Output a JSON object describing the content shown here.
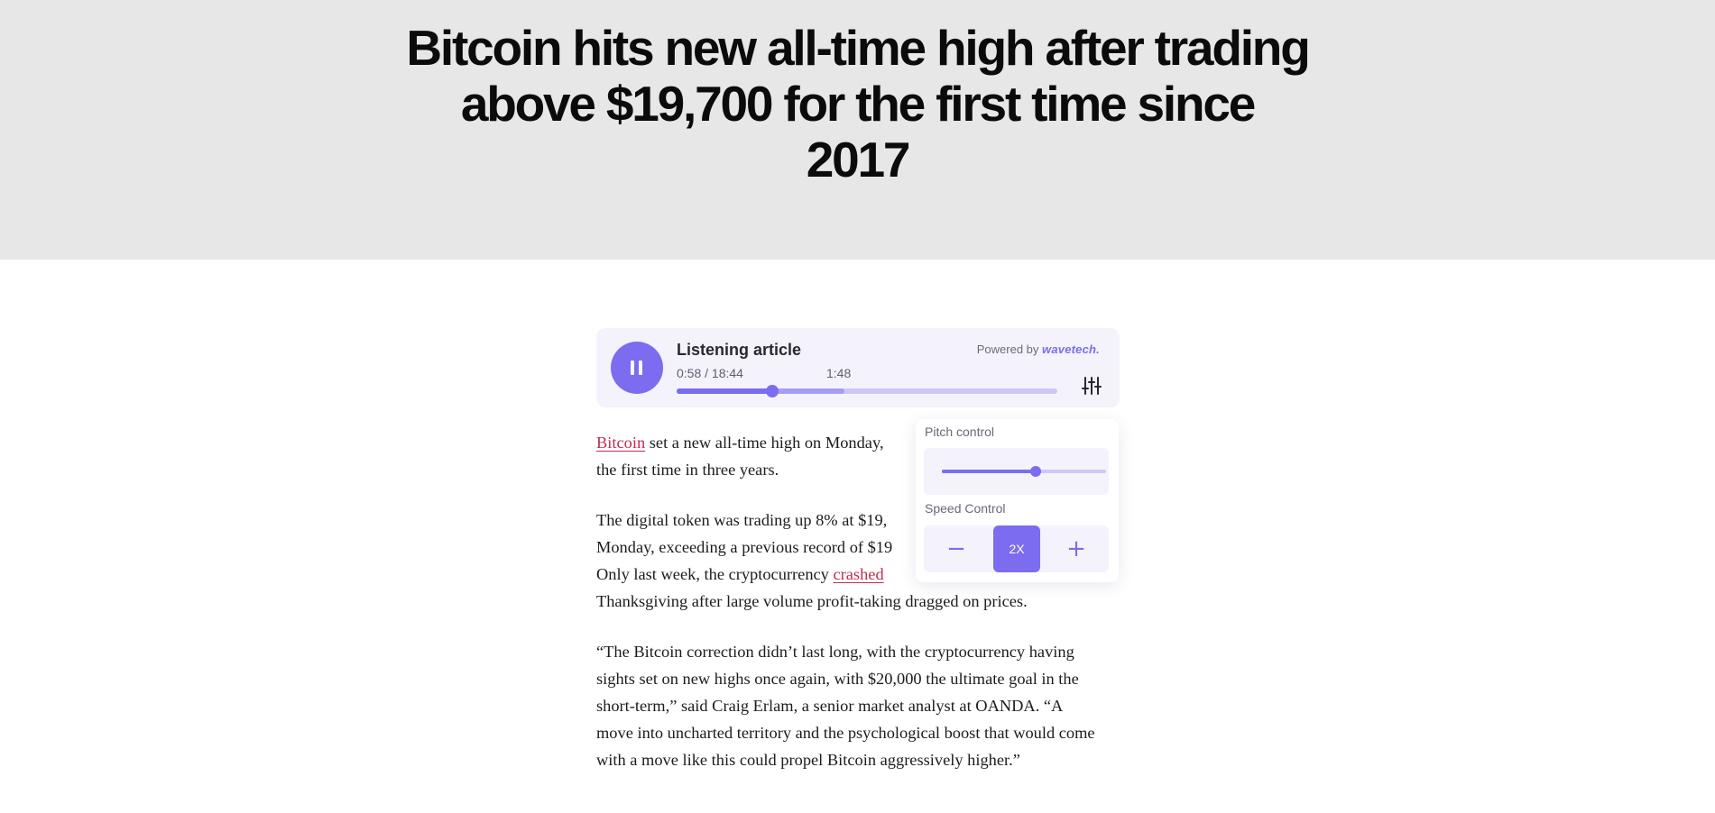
{
  "headline": "Bitcoin hits new all-time high after trading above $19,700 for the first time since 2017",
  "player": {
    "title": "Listening article",
    "powered_by": "Powered by",
    "brand": "wavetech.",
    "time_display": "0:58 / 18:44",
    "hover_time": "1:48",
    "progress_fraction": 0.25,
    "buffer_fraction": 0.44,
    "state": "playing",
    "icons": {
      "play_pause": "pause-icon",
      "settings": "sliders-icon"
    }
  },
  "settings_popup": {
    "pitch_label": "Pitch control",
    "pitch_fraction": 0.57,
    "speed_label": "Speed Control",
    "speed_value": "2X",
    "decrease_symbol": "−",
    "increase_symbol": "+"
  },
  "article": {
    "p1": {
      "link": "Bitcoin",
      "rest_line1": " set a new all-time high on Monday,",
      "line2": "the first time in three years."
    },
    "p2": {
      "line1": "The digital token was trading up 8% at $19,",
      "line2": "Monday, exceeding a previous record of $19",
      "line3_before": "Only last week, the cryptocurrency ",
      "line3_link": "crashed",
      "line4": "Thanksgiving after large volume profit-taking dragged on prices."
    },
    "p3": "“The Bitcoin correction didn’t last long, with the cryptocurrency having sights set on new highs once again, with $20,000 the ultimate goal in the short-term,” said Craig Erlam, a senior market analyst at OANDA. “A move into uncharted territory and the psychological boost that would come with a move like this could propel Bitcoin aggressively higher.”"
  },
  "colors": {
    "accent": "#7b6cf0",
    "accent_light": "#cdc7f7",
    "link": "#c22c52",
    "hero_bg": "#e7e7e8",
    "player_bg": "#f4f3fb"
  }
}
